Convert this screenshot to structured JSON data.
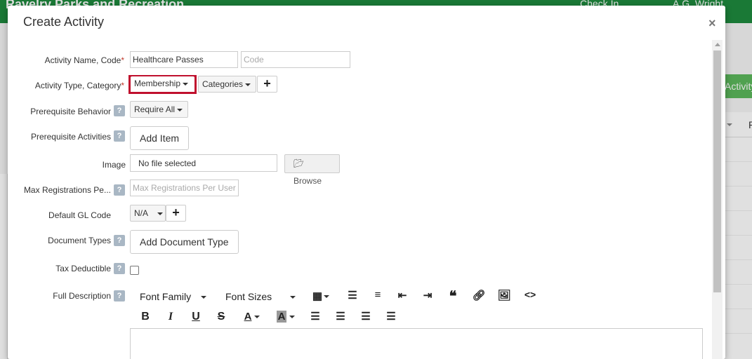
{
  "background": {
    "app_title": "Ravelry Parks and Recreation",
    "check_in": "Check In",
    "user": "A.G. Wright Middle",
    "create_button": "Activity",
    "table_col": "R"
  },
  "modal": {
    "title": "Create Activity",
    "close": "×",
    "fields": {
      "activity_name_label": "Activity Name, Code",
      "activity_name_value": "Healthcare Passes",
      "activity_code_placeholder": "Code",
      "activity_type_label": "Activity Type, Category",
      "activity_type_value": "Membership",
      "category_value": "Categories",
      "prereq_behavior_label": "Prerequisite Behavior",
      "prereq_behavior_value": "Require All",
      "prereq_activities_label": "Prerequisite Activities",
      "add_item_label": "Add Item",
      "image_label": "Image",
      "image_value": "No file selected",
      "browse_label": "Browse",
      "max_reg_label": "Max Registrations Pe...",
      "max_reg_placeholder": "Max Registrations Per User",
      "default_gl_label": "Default GL Code",
      "default_gl_value": "N/A",
      "document_types_label": "Document Types",
      "add_document_type_label": "Add Document Type",
      "tax_deductible_label": "Tax Deductible",
      "full_description_label": "Full Description"
    },
    "required_mark": "*",
    "help_mark": "?",
    "plus_mark": "+",
    "editor_toolbar": {
      "font_family": "Font Family",
      "font_sizes": "Font Sizes",
      "bold": "B",
      "italic": "I",
      "underline": "U",
      "strikethrough": "S",
      "font_color": "A",
      "highlight_color": "A"
    }
  },
  "colors": {
    "header_green": "#1e8a3e",
    "highlight_red": "#c0102e",
    "required_red": "#c0392b"
  }
}
